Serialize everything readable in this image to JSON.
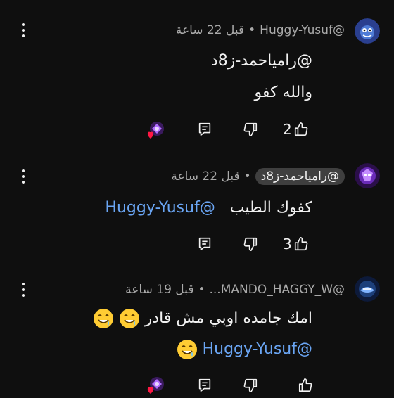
{
  "comments": [
    {
      "author": "@Huggy-Yusuf",
      "time": "قبل 22 ساعة",
      "lines": [
        "@راميا‌حمد-ز8د",
        "والله كفو"
      ],
      "likes": "2"
    },
    {
      "author": "@راميا‌حمد-ز8د",
      "time": "قبل 22 ساعة",
      "text": "كفوك الطيب",
      "mention": "@Huggy-Yusuf",
      "likes": "3"
    },
    {
      "author": "@MANDO_HAGGY_W...",
      "time": "قبل 19 ساعة",
      "text": "امك جامده اوبي مش قادر",
      "mention": "@Huggy-Yusuf"
    }
  ],
  "separator": "•",
  "icons": {
    "more": "more-vert-icon",
    "like": "thumb-up-icon",
    "dislike": "thumb-down-icon",
    "reply": "reply-icon",
    "hearted": "creator-heart-icon"
  },
  "colors": {
    "background": "#0f0f0f",
    "mention": "#6aa5f3",
    "meta": "#aaaaaa",
    "heart": "#ff1744"
  }
}
